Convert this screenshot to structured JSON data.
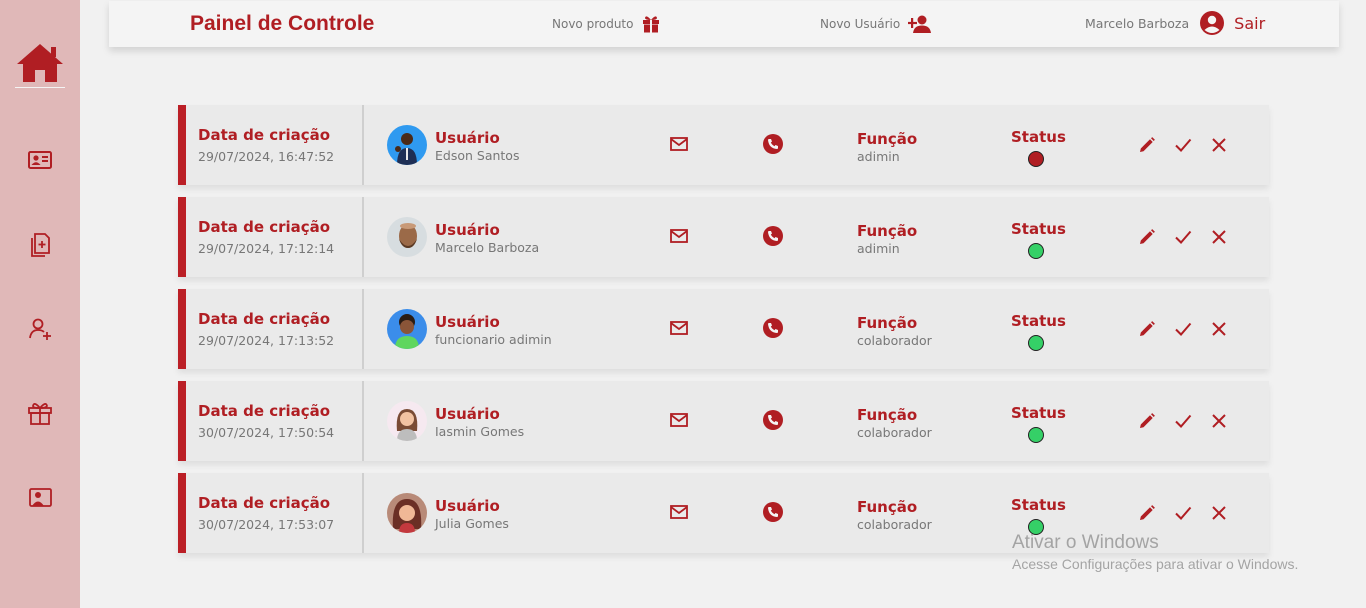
{
  "header": {
    "title": "Painel de Controle",
    "new_product_label": "Novo produto",
    "new_user_label": "Novo Usuário",
    "user_name": "Marcelo Barboza",
    "logout_label": "Sair"
  },
  "sidebar": {
    "items": [
      {
        "icon": "home-icon"
      },
      {
        "icon": "id-card-icon"
      },
      {
        "icon": "document-add-icon"
      },
      {
        "icon": "user-add-icon"
      },
      {
        "icon": "gift-icon"
      },
      {
        "icon": "contact-icon"
      }
    ]
  },
  "labels": {
    "created": "Data de criação",
    "user": "Usuário",
    "role": "Função",
    "status": "Status"
  },
  "colors": {
    "accent": "#b01e23",
    "status_active": "#35d067",
    "status_inactive": "#b01e23"
  },
  "rows": [
    {
      "created": "29/07/2024, 16:47:52",
      "user": "Edson Santos",
      "role": "adimin",
      "status": "inactive"
    },
    {
      "created": "29/07/2024, 17:12:14",
      "user": "Marcelo Barboza",
      "role": "adimin",
      "status": "active"
    },
    {
      "created": "29/07/2024, 17:13:52",
      "user": "funcionario adimin",
      "role": "colaborador",
      "status": "active"
    },
    {
      "created": "30/07/2024, 17:50:54",
      "user": "Iasmin Gomes",
      "role": "colaborador",
      "status": "active"
    },
    {
      "created": "30/07/2024, 17:53:07",
      "user": "Julia Gomes",
      "role": "colaborador",
      "status": "active"
    }
  ],
  "watermark": {
    "title": "Ativar o Windows",
    "subtitle": "Acesse Configurações para ativar o Windows."
  }
}
